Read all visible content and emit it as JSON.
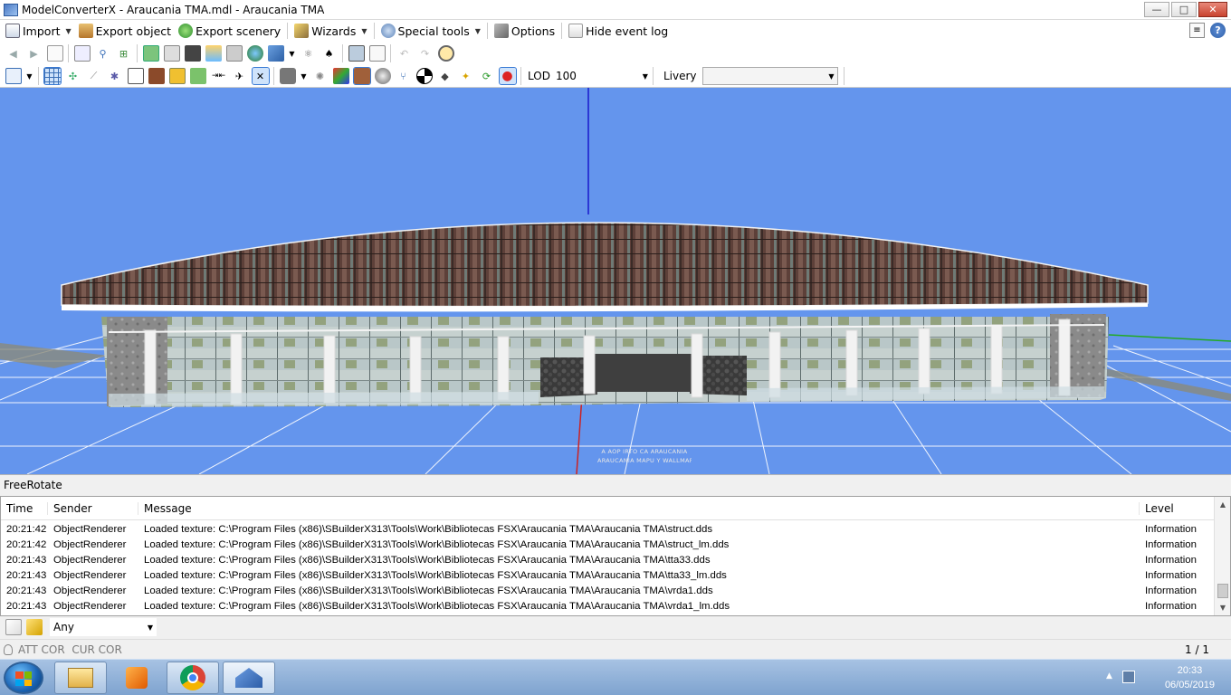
{
  "window": {
    "title": "ModelConverterX - Araucania TMA.mdl - Araucania TMA",
    "minimize": "—",
    "maximize": "□",
    "close": "✕"
  },
  "menu": {
    "import": "Import",
    "export_object": "Export object",
    "export_scenery": "Export scenery",
    "wizards": "Wizards",
    "special_tools": "Special tools",
    "options": "Options",
    "hide_event_log": "Hide event log"
  },
  "toolbar2": {
    "lod_label": "LOD",
    "lod_value": "100",
    "livery_label": "Livery",
    "livery_value": ""
  },
  "viewport": {
    "mode": "FreeRotate",
    "sign_line1": "A AOP IRTO CA ARAUCANIA",
    "sign_line2": "ARAUCANIA MAPU Y WALLMAPU",
    "colors": {
      "background": "#6495ed",
      "grid": "#ffffff",
      "y_axis": "#1a1acc",
      "z_axis": "#cc2222",
      "x_axis": "#22aa22"
    }
  },
  "log": {
    "columns": {
      "time": "Time",
      "sender": "Sender",
      "message": "Message",
      "level": "Level"
    },
    "rows": [
      {
        "time": "20:21:42",
        "sender": "ObjectRenderer",
        "message": "Loaded texture: C:\\Program Files (x86)\\SBuilderX313\\Tools\\Work\\Bibliotecas FSX\\Araucania TMA\\Araucania TMA\\struct.dds",
        "level": "Information"
      },
      {
        "time": "20:21:42",
        "sender": "ObjectRenderer",
        "message": "Loaded texture: C:\\Program Files (x86)\\SBuilderX313\\Tools\\Work\\Bibliotecas FSX\\Araucania TMA\\Araucania TMA\\struct_lm.dds",
        "level": "Information"
      },
      {
        "time": "20:21:43",
        "sender": "ObjectRenderer",
        "message": "Loaded texture: C:\\Program Files (x86)\\SBuilderX313\\Tools\\Work\\Bibliotecas FSX\\Araucania TMA\\Araucania TMA\\tta33.dds",
        "level": "Information"
      },
      {
        "time": "20:21:43",
        "sender": "ObjectRenderer",
        "message": "Loaded texture: C:\\Program Files (x86)\\SBuilderX313\\Tools\\Work\\Bibliotecas FSX\\Araucania TMA\\Araucania TMA\\tta33_lm.dds",
        "level": "Information"
      },
      {
        "time": "20:21:43",
        "sender": "ObjectRenderer",
        "message": "Loaded texture: C:\\Program Files (x86)\\SBuilderX313\\Tools\\Work\\Bibliotecas FSX\\Araucania TMA\\Araucania TMA\\vrda1.dds",
        "level": "Information"
      },
      {
        "time": "20:21:43",
        "sender": "ObjectRenderer",
        "message": "Loaded texture: C:\\Program Files (x86)\\SBuilderX313\\Tools\\Work\\Bibliotecas FSX\\Araucania TMA\\Araucania TMA\\vrda1_lm.dds",
        "level": "Information"
      }
    ]
  },
  "filter": {
    "level_value": "Any"
  },
  "status": {
    "left": "ATT COR  CUR COR",
    "page": "1 / 1"
  },
  "taskbar": {
    "time": "20:33",
    "date": "06/05/2019"
  }
}
